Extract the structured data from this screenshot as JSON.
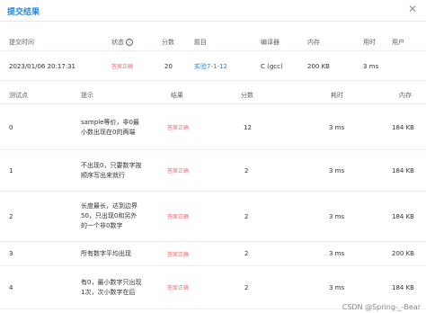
{
  "dialog": {
    "title": "提交结果",
    "close_glyph": "✕"
  },
  "summary": {
    "headers": [
      "提交时间",
      "状态",
      "分数",
      "题目",
      "编译器",
      "内存",
      "用时",
      "用户"
    ],
    "row": {
      "time": "2023/01/06 20:17:31",
      "status": "答案正确",
      "score": "20",
      "problem": "实验7-1-12",
      "compiler": "C (gcc)",
      "memory": "200 KB",
      "duration": "3 ms",
      "user": ""
    }
  },
  "testcases": {
    "headers": [
      "测试点",
      "提示",
      "结果",
      "分数",
      "耗时",
      "内存"
    ],
    "rows": [
      {
        "id": "0",
        "hint": "sample等价，非0最小数出现在0的两端",
        "result": "答案正确",
        "score": "12",
        "time": "3 ms",
        "memory": "184 KB"
      },
      {
        "id": "1",
        "hint": "不出现0，只要数字按顺序写出来就行",
        "result": "答案正确",
        "score": "2",
        "time": "3 ms",
        "memory": "184 KB"
      },
      {
        "id": "2",
        "hint": "长度最长，达到边界50，只出现0和另外的一个非0数字",
        "result": "答案正确",
        "score": "2",
        "time": "3 ms",
        "memory": "184 KB"
      },
      {
        "id": "3",
        "hint": "所有数字平均出现",
        "result": "答案正确",
        "score": "2",
        "time": "3 ms",
        "memory": "200 KB"
      },
      {
        "id": "4",
        "hint": "有0，最小数字只出现1次，次小数字在后",
        "result": "答案正确",
        "score": "2",
        "time": "3 ms",
        "memory": "184 KB"
      }
    ]
  },
  "watermark": "CSDN @Spring-_-Bear",
  "colors": {
    "accent": "#1e88e5",
    "status_ok": "#f56c6c",
    "border": "#ebeef5"
  }
}
